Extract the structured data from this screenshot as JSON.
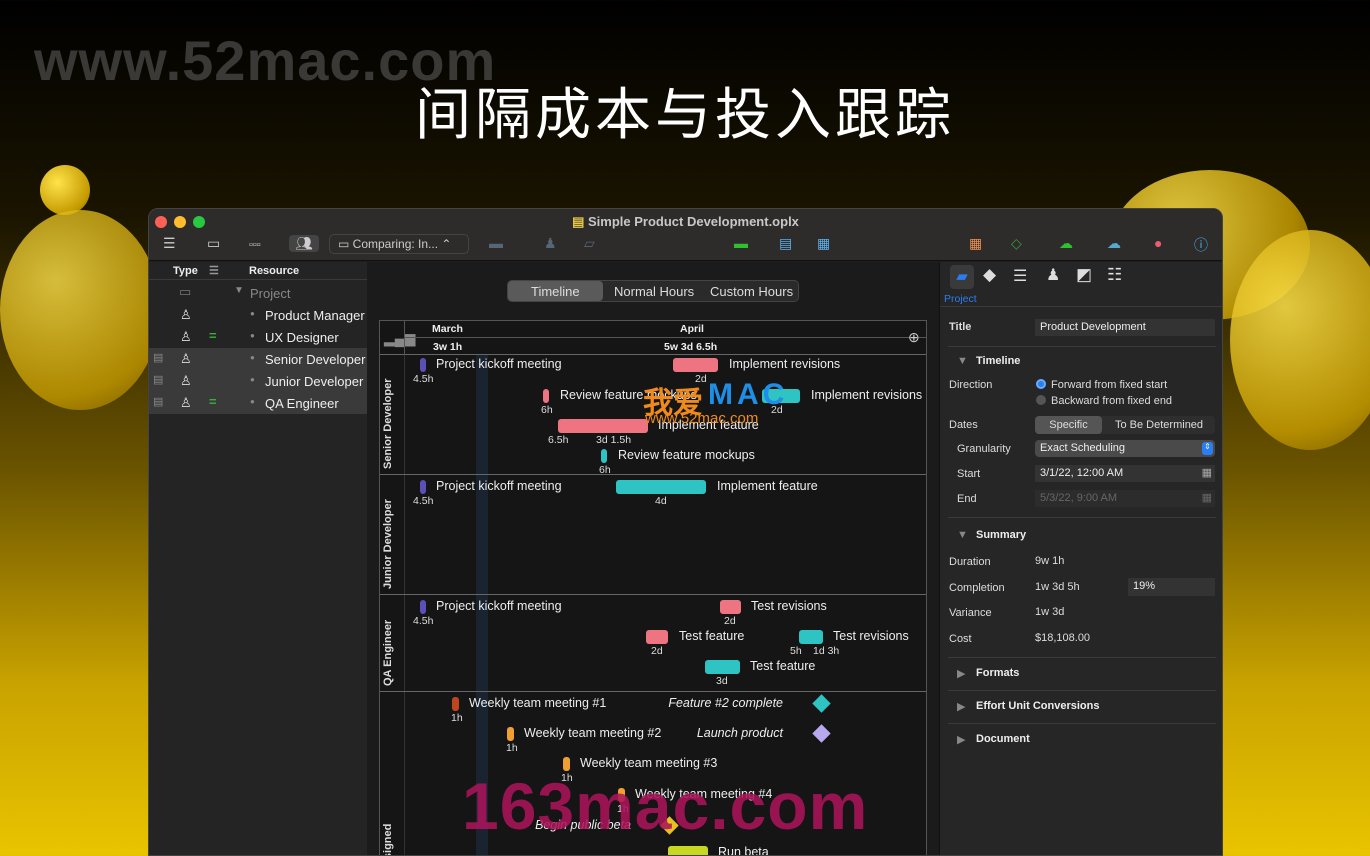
{
  "hero_title": "间隔成本与投入跟踪",
  "watermarks": {
    "top": "www.52mac.com",
    "center_cn": "我爱",
    "center_mac": "MAC",
    "center_url": "www.52mac.com",
    "bottom": "163mac.com"
  },
  "window": {
    "title": "Simple Product Development.oplx"
  },
  "toolbar": {
    "comparing": "Comparing: In...",
    "icons": [
      "outline-icon",
      "gantt-icon",
      "network-icon",
      "resources-icon",
      "link-icon",
      "person-icon",
      "split-icon",
      "level-icon",
      "tracking-icon",
      "catch-up-icon",
      "table-icon",
      "baseline-icon",
      "publish-icon",
      "subscribe-icon",
      "violations-icon",
      "info-icon"
    ]
  },
  "sidebar": {
    "headers": {
      "type": "Type",
      "resource": "Resource"
    },
    "rows": [
      {
        "label": "Project",
        "kind": "group"
      },
      {
        "label": "Product Manager"
      },
      {
        "label": "UX Designer",
        "eq": true
      },
      {
        "label": "Senior Developer",
        "selected": true
      },
      {
        "label": "Junior Developer",
        "selected": true
      },
      {
        "label": "QA Engineer",
        "selected": true,
        "eq": true
      }
    ]
  },
  "view_tabs": [
    {
      "label": "Timeline",
      "active": true
    },
    {
      "label": "Normal Hours"
    },
    {
      "label": "Custom Hours"
    }
  ],
  "gantt": {
    "months": [
      {
        "label": "March",
        "total": "3w 1h"
      },
      {
        "label": "April",
        "total": "5w 3d 6.5h"
      }
    ],
    "lanes": [
      "Senior Developer",
      "Junior Developer",
      "QA Engineer",
      "Unassigned"
    ],
    "colors": {
      "kickoff": "#5b4fb8",
      "pink": "#ef7482",
      "teal": "#2ec4c4",
      "meeting1": "#c0451c",
      "meeting": "#f0a030",
      "beta": "#c8d820"
    },
    "items": [
      {
        "label": "Project kickoff meeting",
        "durs": [
          "4.5h"
        ],
        "color": "kickoff"
      },
      {
        "label": "Implement revisions",
        "durs": [
          "2d"
        ],
        "color": "pink"
      },
      {
        "label": "Review feature mockups",
        "durs": [
          "6h"
        ],
        "color": "pink"
      },
      {
        "label": "Implement revisions",
        "durs": [
          "2d"
        ],
        "color": "teal"
      },
      {
        "label": "Implement feature",
        "durs": [
          "6.5h",
          "3d 1.5h"
        ],
        "color": "pink"
      },
      {
        "label": "Review feature mockups",
        "durs": [
          "6h"
        ],
        "color": "teal"
      },
      {
        "label": "Project kickoff meeting",
        "durs": [
          "4.5h"
        ],
        "color": "kickoff"
      },
      {
        "label": "Implement feature",
        "durs": [
          "4d"
        ],
        "color": "teal"
      },
      {
        "label": "Project kickoff meeting",
        "durs": [
          "4.5h"
        ],
        "color": "kickoff"
      },
      {
        "label": "Test revisions",
        "durs": [
          "2d"
        ],
        "color": "pink"
      },
      {
        "label": "Test feature",
        "durs": [
          "2d"
        ],
        "color": "pink"
      },
      {
        "label": "Test revisions",
        "durs": [
          "5h",
          "1d 3h"
        ],
        "color": "teal"
      },
      {
        "label": "Test feature",
        "durs": [
          "3d"
        ],
        "color": "teal"
      },
      {
        "label": "Weekly team meeting #1",
        "durs": [
          "1h"
        ],
        "color": "meeting1"
      },
      {
        "label": "Weekly team meeting #2",
        "durs": [
          "1h"
        ],
        "color": "meeting"
      },
      {
        "label": "Weekly team meeting #3",
        "durs": [
          "1h"
        ],
        "color": "meeting"
      },
      {
        "label": "Weekly team meeting #4",
        "durs": [
          "1h"
        ],
        "color": "meeting"
      },
      {
        "label": "Run beta",
        "durs": [],
        "color": "beta"
      }
    ],
    "milestones": [
      {
        "label": "Feature #2 complete",
        "color": "#2ec4c4"
      },
      {
        "label": "Launch product",
        "color": "#b8a8f0"
      },
      {
        "label": "Begin public beta",
        "color": "#e8c020"
      }
    ]
  },
  "inspector": {
    "tab": "Project",
    "title_label": "Title",
    "title_value": "Product Development",
    "timeline": "Timeline",
    "direction_label": "Direction",
    "direction_options": [
      {
        "label": "Forward from fixed start",
        "selected": true
      },
      {
        "label": "Backward from fixed end"
      }
    ],
    "dates_label": "Dates",
    "dates_options": [
      {
        "label": "Specific",
        "active": true
      },
      {
        "label": "To Be Determined"
      }
    ],
    "granularity_label": "Granularity",
    "granularity_value": "Exact Scheduling",
    "start_label": "Start",
    "start_value": "3/1/22, 12:00 AM",
    "end_label": "End",
    "end_value": "5/3/22, 9:00 AM",
    "summary": "Summary",
    "duration_label": "Duration",
    "duration": "9w 1h",
    "completion_label": "Completion",
    "completion": "1w 3d 5h",
    "completion_pct": "19%",
    "variance_label": "Variance",
    "variance": "1w 3d",
    "cost_label": "Cost",
    "cost": "$18,108.00",
    "sections": [
      "Formats",
      "Effort Unit Conversions",
      "Document"
    ],
    "accent": "#2a7ef0"
  }
}
